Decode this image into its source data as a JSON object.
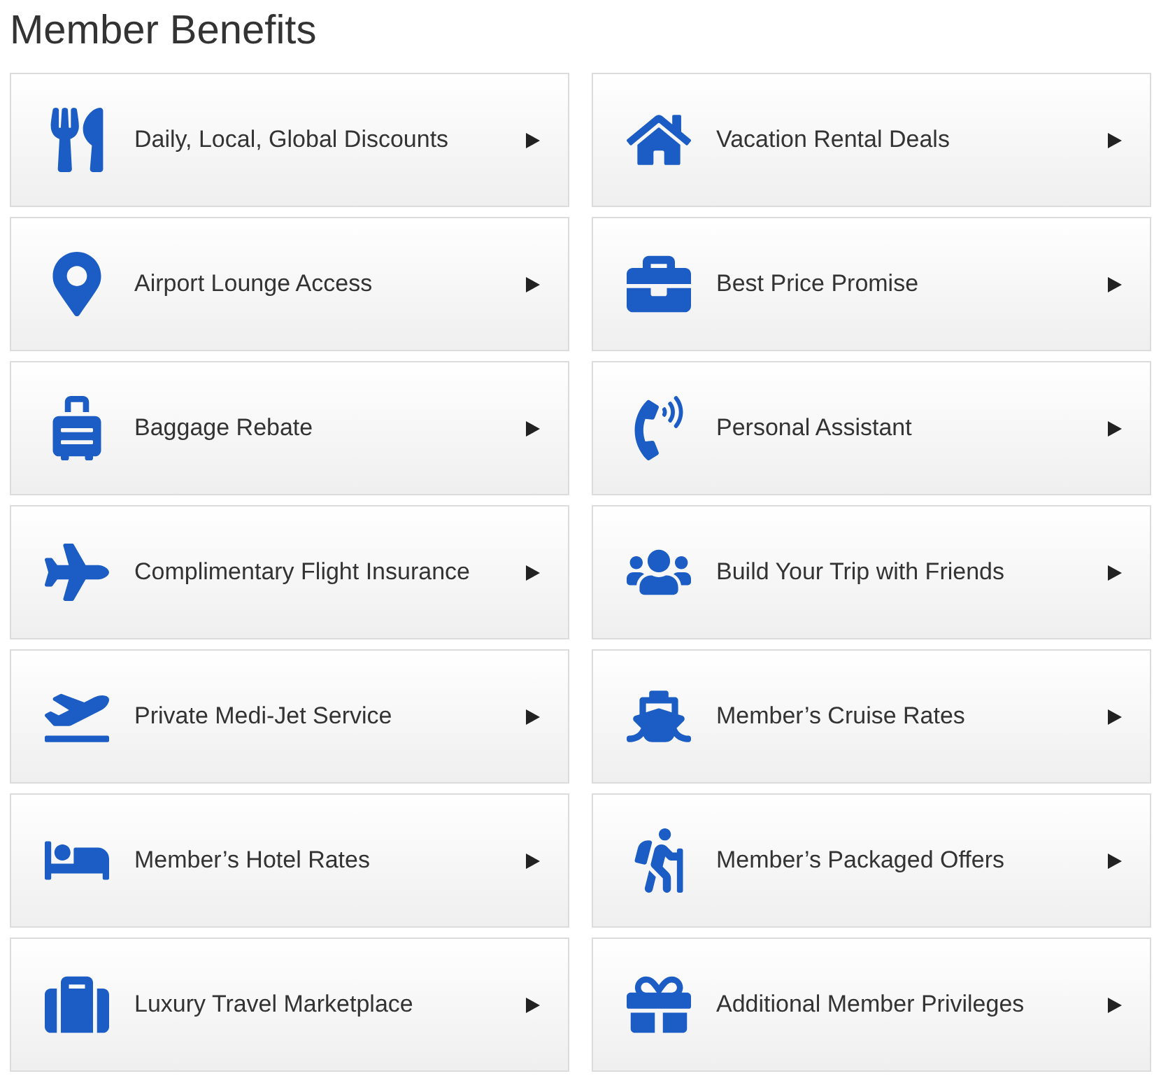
{
  "title": "Member Benefits",
  "benefits": [
    {
      "label": "Daily, Local, Global Discounts"
    },
    {
      "label": "Vacation Rental Deals"
    },
    {
      "label": "Airport Lounge Access"
    },
    {
      "label": "Best Price Promise"
    },
    {
      "label": "Baggage Rebate"
    },
    {
      "label": "Personal Assistant"
    },
    {
      "label": "Complimentary Flight Insurance"
    },
    {
      "label": "Build Your Trip with Friends"
    },
    {
      "label": "Private Medi-Jet Service"
    },
    {
      "label": "Member’s Cruise Rates"
    },
    {
      "label": "Member’s Hotel Rates"
    },
    {
      "label": "Member’s Packaged Offers"
    },
    {
      "label": "Luxury Travel Marketplace"
    },
    {
      "label": "Additional Member Privileges"
    }
  ]
}
